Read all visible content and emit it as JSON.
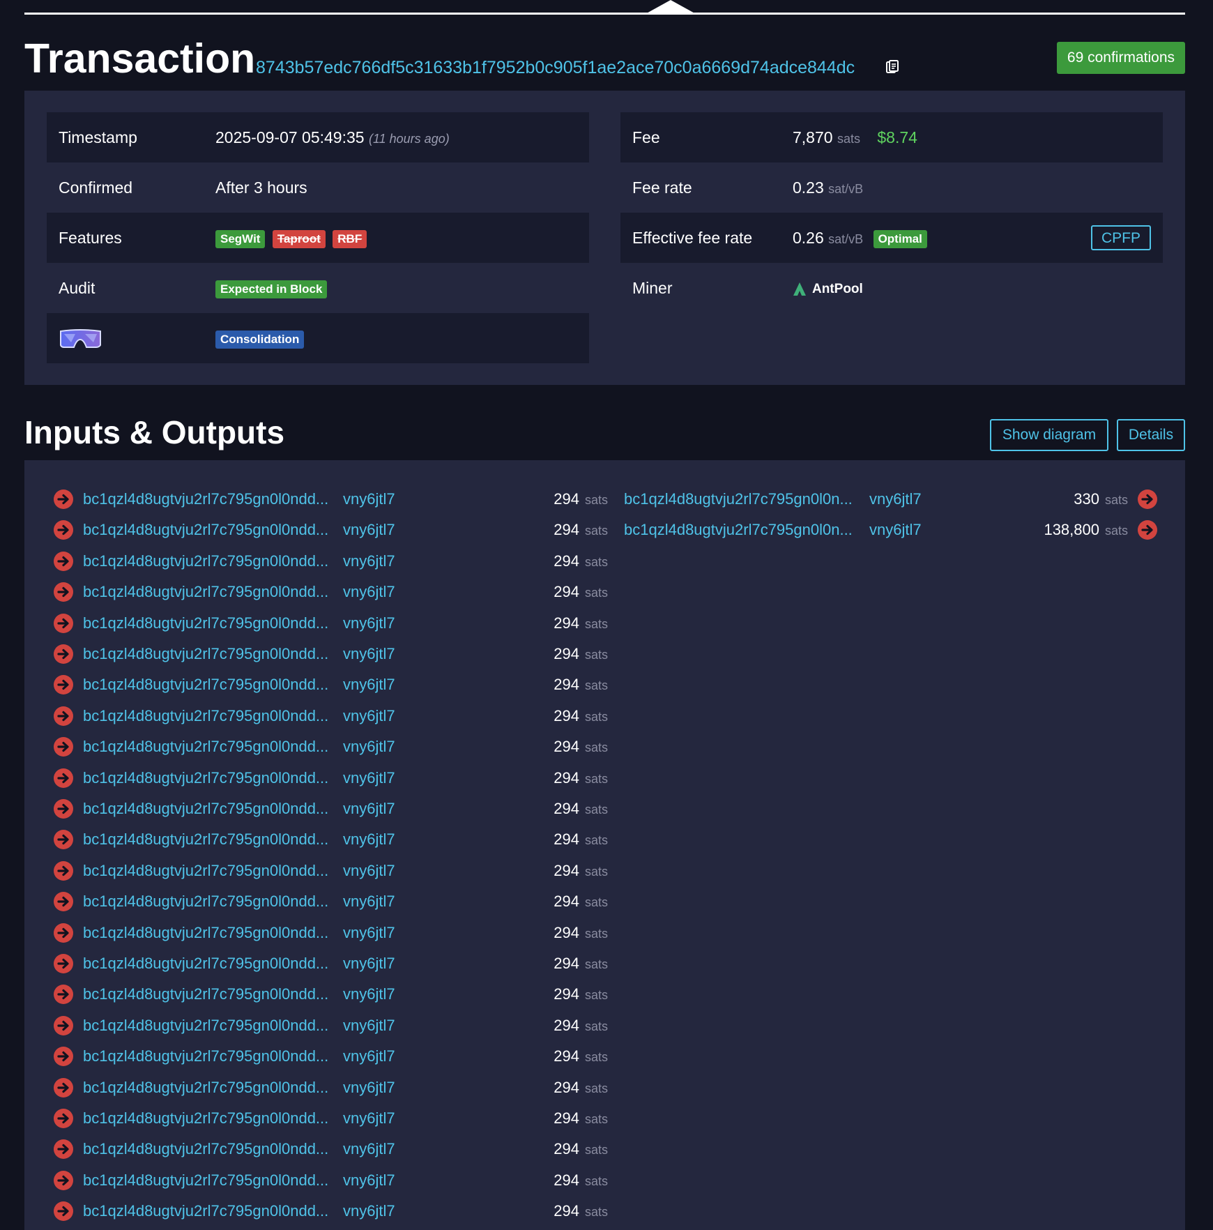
{
  "transaction": {
    "title": "Transaction",
    "txid": "8743b57edc766df5c31633b1f7952b0c905f1ae2ace70c0a6669d74adce844dc",
    "confirmations": "69 confirmations"
  },
  "details": {
    "timestamp_label": "Timestamp",
    "timestamp_value": "2025-09-07 05:49:35",
    "timestamp_relative": "(11 hours ago)",
    "confirmed_label": "Confirmed",
    "confirmed_value": "After 3 hours",
    "features_label": "Features",
    "features": [
      "SegWit",
      "Taproot",
      "RBF"
    ],
    "audit_label": "Audit",
    "audit_badge": "Expected in Block",
    "classification_badge": "Consolidation",
    "fee_label": "Fee",
    "fee_value": "7,870",
    "fee_unit": "sats",
    "fee_fiat": "$8.74",
    "fee_rate_label": "Fee rate",
    "fee_rate_value": "0.23",
    "fee_rate_unit": "sat/vB",
    "eff_fee_label": "Effective fee rate",
    "eff_fee_value": "0.26",
    "eff_fee_unit": "sat/vB",
    "eff_fee_badge": "Optimal",
    "cpfp_button": "CPFP",
    "miner_label": "Miner",
    "miner_name": "AntPool"
  },
  "io": {
    "title": "Inputs & Outputs",
    "show_diagram_button": "Show diagram",
    "details_button": "Details",
    "inputs": [
      {
        "addr_start": "bc1qzl4d8ugtvju2rl7c795gn0l0ndd...",
        "addr_end": "vny6jtl7",
        "amount": "294",
        "unit": "sats"
      },
      {
        "addr_start": "bc1qzl4d8ugtvju2rl7c795gn0l0ndd...",
        "addr_end": "vny6jtl7",
        "amount": "294",
        "unit": "sats"
      },
      {
        "addr_start": "bc1qzl4d8ugtvju2rl7c795gn0l0ndd...",
        "addr_end": "vny6jtl7",
        "amount": "294",
        "unit": "sats"
      },
      {
        "addr_start": "bc1qzl4d8ugtvju2rl7c795gn0l0ndd...",
        "addr_end": "vny6jtl7",
        "amount": "294",
        "unit": "sats"
      },
      {
        "addr_start": "bc1qzl4d8ugtvju2rl7c795gn0l0ndd...",
        "addr_end": "vny6jtl7",
        "amount": "294",
        "unit": "sats"
      },
      {
        "addr_start": "bc1qzl4d8ugtvju2rl7c795gn0l0ndd...",
        "addr_end": "vny6jtl7",
        "amount": "294",
        "unit": "sats"
      },
      {
        "addr_start": "bc1qzl4d8ugtvju2rl7c795gn0l0ndd...",
        "addr_end": "vny6jtl7",
        "amount": "294",
        "unit": "sats"
      },
      {
        "addr_start": "bc1qzl4d8ugtvju2rl7c795gn0l0ndd...",
        "addr_end": "vny6jtl7",
        "amount": "294",
        "unit": "sats"
      },
      {
        "addr_start": "bc1qzl4d8ugtvju2rl7c795gn0l0ndd...",
        "addr_end": "vny6jtl7",
        "amount": "294",
        "unit": "sats"
      },
      {
        "addr_start": "bc1qzl4d8ugtvju2rl7c795gn0l0ndd...",
        "addr_end": "vny6jtl7",
        "amount": "294",
        "unit": "sats"
      },
      {
        "addr_start": "bc1qzl4d8ugtvju2rl7c795gn0l0ndd...",
        "addr_end": "vny6jtl7",
        "amount": "294",
        "unit": "sats"
      },
      {
        "addr_start": "bc1qzl4d8ugtvju2rl7c795gn0l0ndd...",
        "addr_end": "vny6jtl7",
        "amount": "294",
        "unit": "sats"
      },
      {
        "addr_start": "bc1qzl4d8ugtvju2rl7c795gn0l0ndd...",
        "addr_end": "vny6jtl7",
        "amount": "294",
        "unit": "sats"
      },
      {
        "addr_start": "bc1qzl4d8ugtvju2rl7c795gn0l0ndd...",
        "addr_end": "vny6jtl7",
        "amount": "294",
        "unit": "sats"
      },
      {
        "addr_start": "bc1qzl4d8ugtvju2rl7c795gn0l0ndd...",
        "addr_end": "vny6jtl7",
        "amount": "294",
        "unit": "sats"
      },
      {
        "addr_start": "bc1qzl4d8ugtvju2rl7c795gn0l0ndd...",
        "addr_end": "vny6jtl7",
        "amount": "294",
        "unit": "sats"
      },
      {
        "addr_start": "bc1qzl4d8ugtvju2rl7c795gn0l0ndd...",
        "addr_end": "vny6jtl7",
        "amount": "294",
        "unit": "sats"
      },
      {
        "addr_start": "bc1qzl4d8ugtvju2rl7c795gn0l0ndd...",
        "addr_end": "vny6jtl7",
        "amount": "294",
        "unit": "sats"
      },
      {
        "addr_start": "bc1qzl4d8ugtvju2rl7c795gn0l0ndd...",
        "addr_end": "vny6jtl7",
        "amount": "294",
        "unit": "sats"
      },
      {
        "addr_start": "bc1qzl4d8ugtvju2rl7c795gn0l0ndd...",
        "addr_end": "vny6jtl7",
        "amount": "294",
        "unit": "sats"
      },
      {
        "addr_start": "bc1qzl4d8ugtvju2rl7c795gn0l0ndd...",
        "addr_end": "vny6jtl7",
        "amount": "294",
        "unit": "sats"
      },
      {
        "addr_start": "bc1qzl4d8ugtvju2rl7c795gn0l0ndd...",
        "addr_end": "vny6jtl7",
        "amount": "294",
        "unit": "sats"
      },
      {
        "addr_start": "bc1qzl4d8ugtvju2rl7c795gn0l0ndd...",
        "addr_end": "vny6jtl7",
        "amount": "294",
        "unit": "sats"
      },
      {
        "addr_start": "bc1qzl4d8ugtvju2rl7c795gn0l0ndd...",
        "addr_end": "vny6jtl7",
        "amount": "294",
        "unit": "sats"
      }
    ],
    "outputs": [
      {
        "addr_start": "bc1qzl4d8ugtvju2rl7c795gn0l0n...",
        "addr_end": "vny6jtl7",
        "amount": "330",
        "unit": "sats"
      },
      {
        "addr_start": "bc1qzl4d8ugtvju2rl7c795gn0l0n...",
        "addr_end": "vny6jtl7",
        "amount": "138,800",
        "unit": "sats"
      }
    ]
  },
  "colors": {
    "background": "#11131f",
    "panel": "#24273e",
    "link": "#4fc3e8",
    "green": "#3c9a3c",
    "red": "#d2443f",
    "blue": "#2b5bab"
  },
  "icons": {
    "input_arrow": "arrow-right-circle-icon",
    "output_arrow": "arrow-right-circle-icon",
    "copy": "clipboard-icon",
    "miner": "antpool-logo-icon",
    "goggles": "goggles-icon"
  }
}
